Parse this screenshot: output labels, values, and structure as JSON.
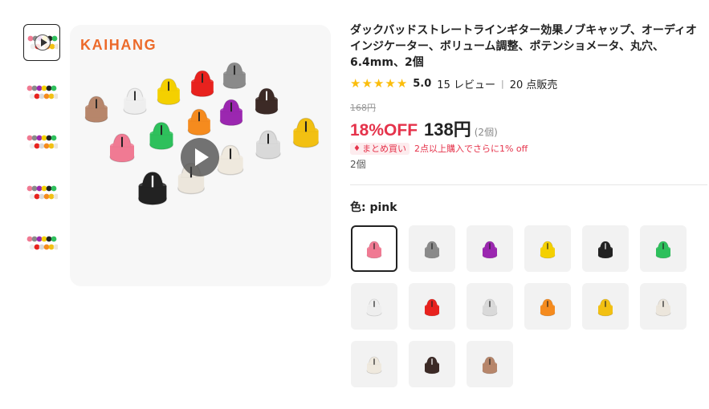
{
  "gallery": {
    "brand": "KAIHANG",
    "thumbnails": [
      {
        "icon": "video-thumbnail-icon",
        "active": true
      },
      {
        "icon": "image-thumbnail-icon",
        "active": false
      },
      {
        "icon": "image-thumbnail-icon",
        "active": false
      },
      {
        "icon": "image-thumbnail-icon",
        "active": false
      },
      {
        "icon": "image-thumbnail-icon",
        "active": false
      },
      {
        "icon": "image-thumbnail-icon",
        "active": false
      }
    ],
    "play_icon": "play-icon"
  },
  "product": {
    "title": "ダックバッドストレートラインギター効果ノブキャップ、オーディオインジケーター、ボリューム調整、ポテンショメータ、丸穴、6.4mm、2個",
    "rating": {
      "stars": 5,
      "value": "5.0",
      "reviews": "15 レビュー",
      "sold": "20 点販売"
    },
    "original_price": "168円",
    "discount": "18%OFF",
    "price": "138円",
    "unit": "(2個)",
    "promo": {
      "badge": "まとめ買い",
      "text": "2点以上購入でさらに1% off"
    },
    "quantity_text": "2個"
  },
  "variants": {
    "label": "色: pink",
    "options": [
      {
        "color": "#f07a93",
        "selected": true
      },
      {
        "color": "#8a8a8a",
        "selected": false
      },
      {
        "color": "#9b27b0",
        "selected": false
      },
      {
        "color": "#f4d000",
        "selected": false
      },
      {
        "color": "#222222",
        "selected": false
      },
      {
        "color": "#2ec05c",
        "selected": false
      },
      {
        "color": "#eeeeee",
        "selected": false
      },
      {
        "color": "#e8221e",
        "selected": false
      },
      {
        "color": "#d9d9d9",
        "selected": false
      },
      {
        "color": "#f58b1e",
        "selected": false
      },
      {
        "color": "#f2c012",
        "selected": false
      },
      {
        "color": "#ece6dc",
        "selected": false
      },
      {
        "color": "#efe9de",
        "selected": false
      },
      {
        "color": "#3c2a26",
        "selected": false
      },
      {
        "color": "#b7866b",
        "selected": false
      }
    ]
  }
}
